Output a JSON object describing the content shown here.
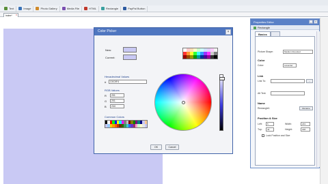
{
  "toolbar": {
    "items": [
      {
        "label": "Text",
        "icon": "text-icon",
        "color": "#5a8f3a"
      },
      {
        "label": "Image",
        "icon": "image-icon",
        "color": "#3a73b8"
      },
      {
        "label": "Photo Gallery",
        "icon": "photo-gallery-icon",
        "color": "#d08a2a"
      },
      {
        "label": "Media File",
        "icon": "media-file-icon",
        "color": "#7a4fb0"
      },
      {
        "label": "HTML",
        "icon": "html-icon",
        "color": "#c0392b"
      },
      {
        "label": "Rectangle",
        "icon": "rectangle-icon",
        "color": "#3aa0a0"
      },
      {
        "label": "PayPal Button",
        "icon": "paypal-icon",
        "color": "#2c5aa0"
      }
    ]
  },
  "tab": {
    "label": "index*"
  },
  "dialog": {
    "title": "Color Picker",
    "new_label": "New:",
    "current_label": "Current:",
    "hex_label": "Hexadecimal Values",
    "hex_prefix": "#",
    "hex_value": "C9C9F4",
    "rgb_label": "RGB Values",
    "r_label": "R",
    "r_value": "201",
    "g_label": "G",
    "g_value": "201",
    "b_label": "B",
    "b_value": "244",
    "common_label": "Common Colors",
    "ok_label": "OK",
    "cancel_label": "Cancel",
    "new_color": "#c9c9f4",
    "current_color": "#c9c9f4"
  },
  "panel": {
    "title": "Properties Editor",
    "subtitle": "Rectangle",
    "tab_basics": "Basics",
    "tab_empty": "",
    "shape_label": "Picture Shape:",
    "shape_value": "Medium Rounded",
    "color_header": "Color",
    "color_label": "Color:",
    "color_value": "Lavender",
    "link_header": "Link",
    "link_to_label": "Link To:",
    "link_to_value": "",
    "link_btn": "...",
    "alt_label": "Alt Text:",
    "alt_value": "",
    "name_header": "Name",
    "name_label": "Rectangle1",
    "rename_btn": "Rename",
    "pos_header": "Position & Size",
    "left_label": "Left:",
    "left_value": "5",
    "width_label": "Width:",
    "width_value": "233",
    "top_label": "Top:",
    "top_value": "42",
    "height_label": "Height:",
    "height_value": "228",
    "lock_label": "Lock Position and Size"
  },
  "colors": {
    "top_palette": [
      "#ffffff",
      "#ffcccc",
      "#ffe0b3",
      "#ffffcc",
      "#ccffcc",
      "#ccffff",
      "#cce0ff",
      "#e0ccff",
      "#ffccff",
      "#f2f2f2",
      "#ff3333",
      "#ff9933",
      "#ffff33",
      "#33ff33",
      "#33ffff",
      "#3399ff",
      "#9933ff",
      "#ff33ff",
      "#cccccc",
      "#808080",
      "#990000",
      "#994c00",
      "#999900",
      "#009900",
      "#009999",
      "#003399",
      "#4c0099",
      "#990099",
      "#333333",
      "#000000"
    ],
    "common_palette": [
      "#000000",
      "#ffffff",
      "#ff0000",
      "#00ff00",
      "#0000ff",
      "#ffff00",
      "#00ffff",
      "#ff00ff",
      "#808080",
      "#c0c0c0",
      "#800000",
      "#808000",
      "#008000",
      "#800080",
      "#008080",
      "#000080",
      "#c9c9f4",
      "#ffcc99",
      "#c9c9f4",
      "#99ccff",
      "#ffcc00",
      "#ff9900",
      "#ff6600",
      "#cc3300",
      "#663300",
      "#336600",
      "#339966",
      "#33cccc",
      "#3366ff",
      "#6633cc",
      "#993366",
      "#ff99cc",
      "#ccffcc",
      "#ffffcc",
      "#e6e6e6",
      "#c9c9f4"
    ]
  }
}
